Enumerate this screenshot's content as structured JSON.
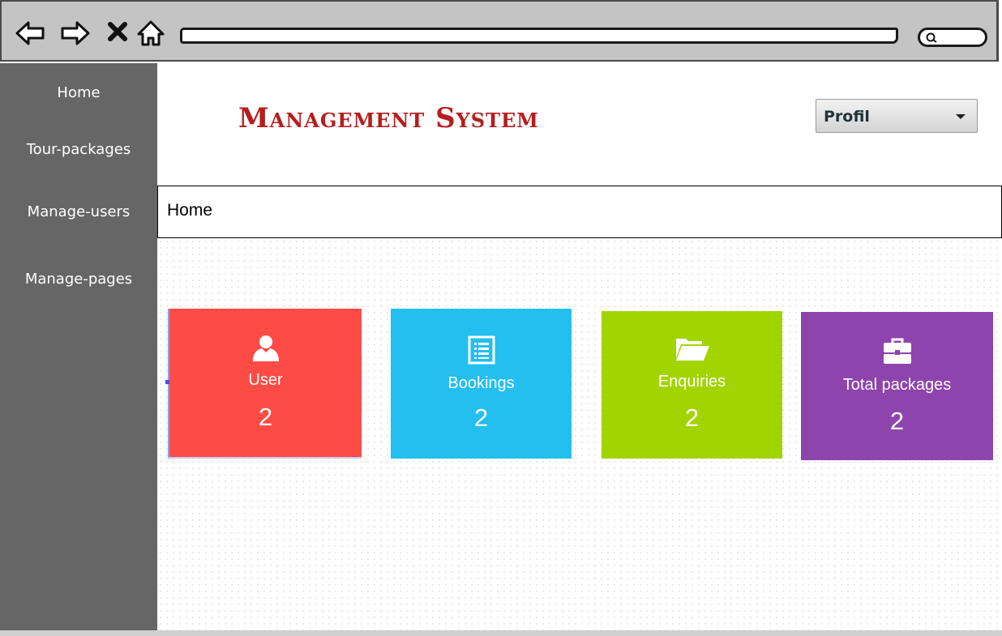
{
  "browser": {
    "back_icon": "back-arrow-icon",
    "forward_icon": "forward-arrow-icon",
    "close_icon": "close-icon",
    "home_icon": "home-icon",
    "search_icon": "search-icon"
  },
  "sidebar": {
    "items": [
      {
        "label": "Home"
      },
      {
        "label": "Tour-packages"
      },
      {
        "label": "Manage-users"
      },
      {
        "label": "Manage-pages"
      }
    ]
  },
  "header": {
    "title": "Management System",
    "title_color": "#b81d1d",
    "profile_select": {
      "value": "Profil"
    }
  },
  "breadcrumb": {
    "text": "Home"
  },
  "stats": [
    {
      "label": "User",
      "value": "2",
      "icon": "user-icon",
      "color": "#ff4b45"
    },
    {
      "label": "Bookings",
      "value": "2",
      "icon": "list-document-icon",
      "color": "#22bfef"
    },
    {
      "label": "Enquiries",
      "value": "2",
      "icon": "folder-open-icon",
      "color": "#a2d400"
    },
    {
      "label": "Total packages",
      "value": "2",
      "icon": "briefcase-icon",
      "color": "#8e44ad"
    }
  ]
}
